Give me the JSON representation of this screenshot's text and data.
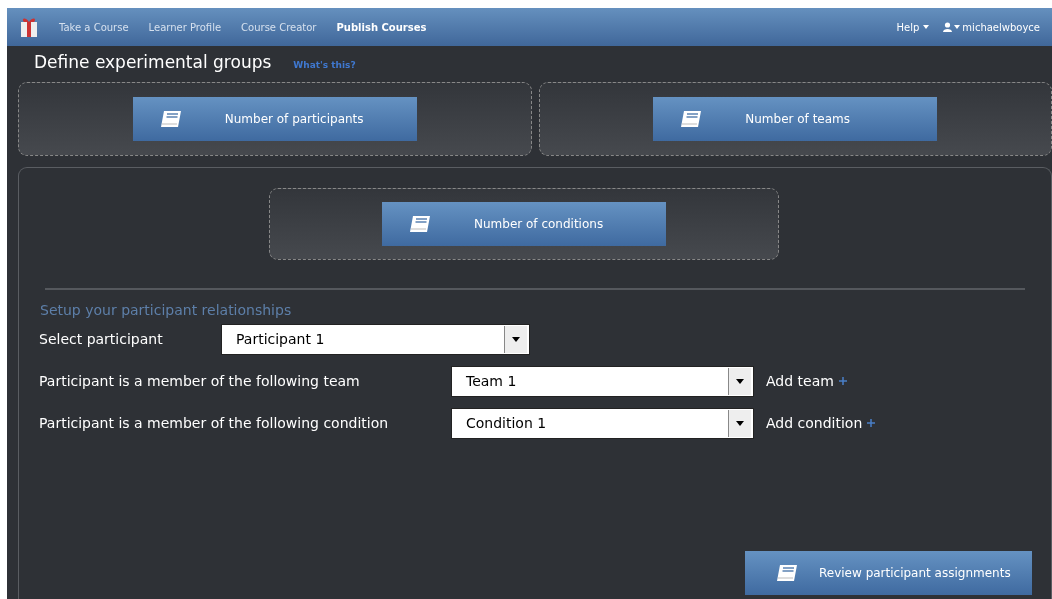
{
  "navbar": {
    "links": [
      {
        "label": "Take a Course",
        "selected": false
      },
      {
        "label": "Learner Profile",
        "selected": false
      },
      {
        "label": "Course Creator",
        "selected": false
      },
      {
        "label": "Publish Courses",
        "selected": true
      }
    ],
    "help": "Help",
    "user": "michaelwboyce"
  },
  "page": {
    "title": "Define experimental groups",
    "help_link": "What's this?"
  },
  "group_buttons": [
    "Number of participants",
    "Number of teams"
  ],
  "conditions_button": "Number of conditions",
  "relationships": {
    "heading": "Setup your participant relationships",
    "rows": [
      {
        "label": "Select participant",
        "value": "Participant 1"
      },
      {
        "label": "Participant is a member of the following team",
        "value": "Team 1",
        "add": "Add team"
      },
      {
        "label": "Participant is a member of the following condition",
        "value": "Condition 1",
        "add": "Add condition"
      }
    ]
  },
  "review_button": "Review participant assignments"
}
